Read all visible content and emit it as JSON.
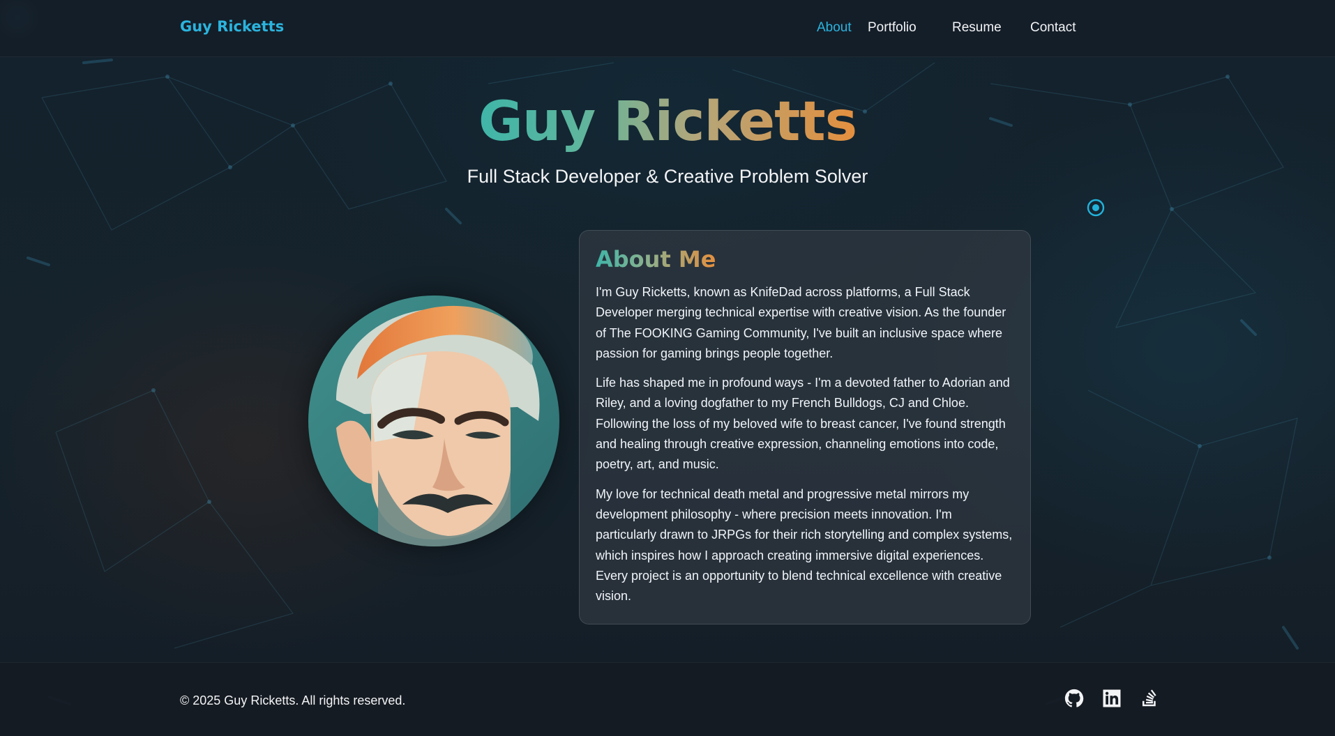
{
  "brand": "Guy Ricketts",
  "nav": {
    "items": [
      {
        "label": "About",
        "active": true
      },
      {
        "label": "Portfolio",
        "active": false
      },
      {
        "label": "Resume",
        "active": false
      },
      {
        "label": "Contact",
        "active": false
      }
    ]
  },
  "hero": {
    "title": "Guy Ricketts",
    "subtitle": "Full Stack Developer & Creative Problem Solver"
  },
  "about": {
    "heading": "About Me",
    "paragraphs": [
      "I'm Guy Ricketts, known as KnifeDad across platforms, a Full Stack Developer merging technical expertise with creative vision. As the founder of The FOOKING Gaming Community, I've built an inclusive space where passion for gaming brings people together.",
      "Life has shaped me in profound ways - I'm a devoted father to Adorian and Riley, and a loving dogfather to my French Bulldogs, CJ and Chloe. Following the loss of my beloved wife to breast cancer, I've found strength and healing through creative expression, channeling emotions into code, poetry, art, and music.",
      "My love for technical death metal and progressive metal mirrors my development philosophy - where precision meets innovation. I'm particularly drawn to JRPGs for their rich storytelling and complex systems, which inspires how I approach creating immersive digital experiences. Every project is an opportunity to blend technical excellence with creative vision."
    ]
  },
  "footer": {
    "copyright": "© 2025 Guy Ricketts. All rights reserved.",
    "social_icons": [
      "github-icon",
      "linkedin-icon",
      "stackoverflow-icon"
    ]
  },
  "colors": {
    "accent": "#2bb4de",
    "gradient_start": "#3fb5a8",
    "gradient_end": "#e48f3e",
    "background": "#14202a"
  }
}
